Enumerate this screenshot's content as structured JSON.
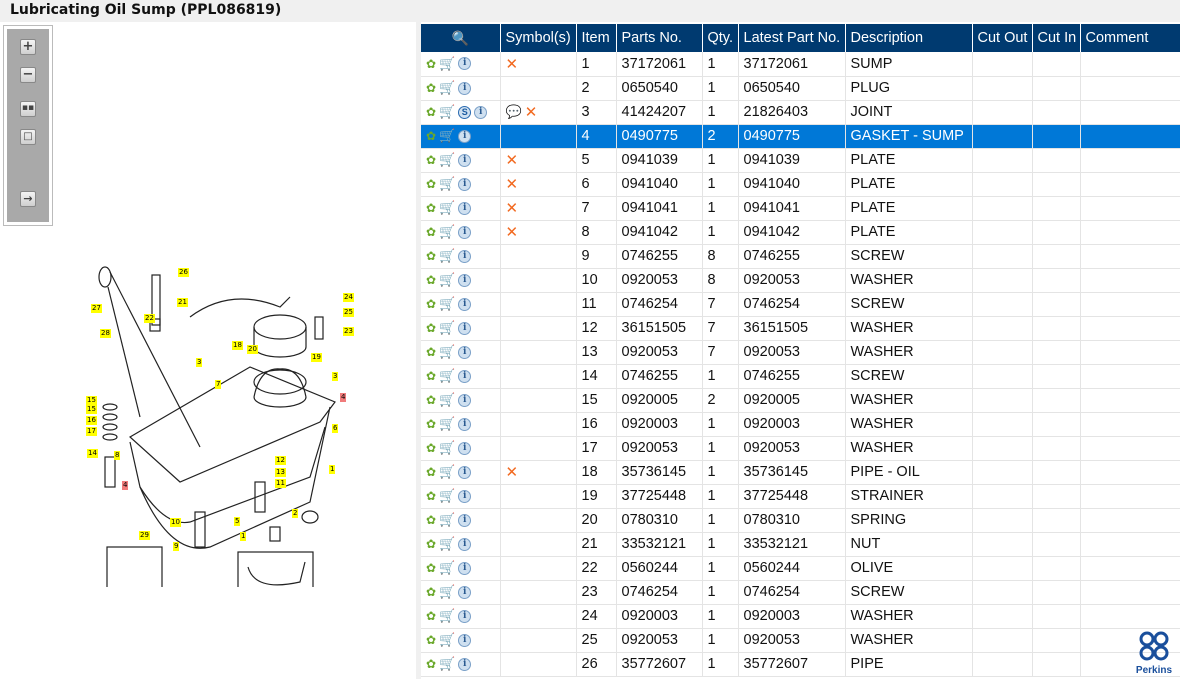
{
  "title": "Lubricating Oil Sump (PPL086819)",
  "toolbar": {
    "zoom_in": "zoom-in",
    "zoom_out": "zoom-out",
    "fit_all": "fit-all",
    "fit_window": "fit-window",
    "export": "export"
  },
  "diagram": {
    "callouts": [
      "26",
      "21",
      "22",
      "27",
      "28",
      "24",
      "25",
      "23",
      "18",
      "20",
      "19",
      "3",
      "3",
      "7",
      "4",
      "15",
      "15",
      "16",
      "17",
      "6",
      "14",
      "8",
      "12",
      "13",
      "1",
      "11",
      "4",
      "2",
      "10",
      "5",
      "29",
      "9",
      "1"
    ]
  },
  "table": {
    "columns": [
      "",
      "Symbol(s)",
      "Item",
      "Parts No.",
      "Qty.",
      "Latest Part No.",
      "Description",
      "Cut Out",
      "Cut In",
      "Comment"
    ],
    "rows": [
      {
        "item": "1",
        "part": "37172061",
        "qty": "1",
        "latest": "37172061",
        "desc": "SUMP",
        "symbols": [
          "cross"
        ]
      },
      {
        "item": "2",
        "part": "0650540",
        "qty": "1",
        "latest": "0650540",
        "desc": "PLUG",
        "symbols": []
      },
      {
        "item": "3",
        "part": "41424207",
        "qty": "1",
        "latest": "21826403",
        "desc": "JOINT",
        "symbols": [
          "note",
          "cross"
        ],
        "s_badge": true
      },
      {
        "item": "4",
        "part": "0490775",
        "qty": "2",
        "latest": "0490775",
        "desc": "GASKET - SUMP",
        "symbols": [],
        "selected": true
      },
      {
        "item": "5",
        "part": "0941039",
        "qty": "1",
        "latest": "0941039",
        "desc": "PLATE",
        "symbols": [
          "cross"
        ]
      },
      {
        "item": "6",
        "part": "0941040",
        "qty": "1",
        "latest": "0941040",
        "desc": "PLATE",
        "symbols": [
          "cross"
        ]
      },
      {
        "item": "7",
        "part": "0941041",
        "qty": "1",
        "latest": "0941041",
        "desc": "PLATE",
        "symbols": [
          "cross"
        ]
      },
      {
        "item": "8",
        "part": "0941042",
        "qty": "1",
        "latest": "0941042",
        "desc": "PLATE",
        "symbols": [
          "cross"
        ]
      },
      {
        "item": "9",
        "part": "0746255",
        "qty": "8",
        "latest": "0746255",
        "desc": "SCREW",
        "symbols": []
      },
      {
        "item": "10",
        "part": "0920053",
        "qty": "8",
        "latest": "0920053",
        "desc": "WASHER",
        "symbols": []
      },
      {
        "item": "11",
        "part": "0746254",
        "qty": "7",
        "latest": "0746254",
        "desc": "SCREW",
        "symbols": []
      },
      {
        "item": "12",
        "part": "36151505",
        "qty": "7",
        "latest": "36151505",
        "desc": "WASHER",
        "symbols": []
      },
      {
        "item": "13",
        "part": "0920053",
        "qty": "7",
        "latest": "0920053",
        "desc": "WASHER",
        "symbols": []
      },
      {
        "item": "14",
        "part": "0746255",
        "qty": "1",
        "latest": "0746255",
        "desc": "SCREW",
        "symbols": []
      },
      {
        "item": "15",
        "part": "0920005",
        "qty": "2",
        "latest": "0920005",
        "desc": "WASHER",
        "symbols": []
      },
      {
        "item": "16",
        "part": "0920003",
        "qty": "1",
        "latest": "0920003",
        "desc": "WASHER",
        "symbols": []
      },
      {
        "item": "17",
        "part": "0920053",
        "qty": "1",
        "latest": "0920053",
        "desc": "WASHER",
        "symbols": []
      },
      {
        "item": "18",
        "part": "35736145",
        "qty": "1",
        "latest": "35736145",
        "desc": "PIPE - OIL",
        "symbols": [
          "cross"
        ]
      },
      {
        "item": "19",
        "part": "37725448",
        "qty": "1",
        "latest": "37725448",
        "desc": "STRAINER",
        "symbols": []
      },
      {
        "item": "20",
        "part": "0780310",
        "qty": "1",
        "latest": "0780310",
        "desc": "SPRING",
        "symbols": []
      },
      {
        "item": "21",
        "part": "33532121",
        "qty": "1",
        "latest": "33532121",
        "desc": "NUT",
        "symbols": []
      },
      {
        "item": "22",
        "part": "0560244",
        "qty": "1",
        "latest": "0560244",
        "desc": "OLIVE",
        "symbols": []
      },
      {
        "item": "23",
        "part": "0746254",
        "qty": "1",
        "latest": "0746254",
        "desc": "SCREW",
        "symbols": []
      },
      {
        "item": "24",
        "part": "0920003",
        "qty": "1",
        "latest": "0920003",
        "desc": "WASHER",
        "symbols": []
      },
      {
        "item": "25",
        "part": "0920053",
        "qty": "1",
        "latest": "0920053",
        "desc": "WASHER",
        "symbols": []
      },
      {
        "item": "26",
        "part": "35772607",
        "qty": "1",
        "latest": "35772607",
        "desc": "PIPE",
        "symbols": []
      }
    ]
  },
  "logo": {
    "text": "Perkins"
  },
  "colors": {
    "header": "#003a70",
    "selected": "#0078d7",
    "cross": "#f26a21"
  }
}
